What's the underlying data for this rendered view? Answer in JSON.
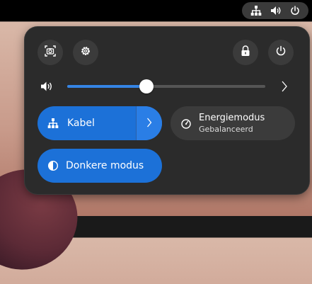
{
  "top_bar": {
    "icons": [
      "network-wired-icon",
      "volume-icon",
      "power-icon"
    ]
  },
  "panel": {
    "header_buttons": {
      "screenshot": "screenshot-icon",
      "settings": "gear-icon",
      "lock": "lock-icon",
      "power": "power-icon"
    },
    "volume": {
      "level_percent": 40,
      "icon": "volume-icon",
      "expand_icon": "chevron-right-icon"
    },
    "toggles": {
      "wired": {
        "label": "Kabel",
        "active": true
      },
      "power_mode": {
        "label": "Energiemodus",
        "sublabel": "Gebalanceerd",
        "active": false
      },
      "dark_mode": {
        "label": "Donkere modus",
        "active": true
      }
    }
  },
  "colors": {
    "accent": "#1c71d8",
    "panel": "#2b2b2b",
    "button": "#3b3b3b"
  }
}
